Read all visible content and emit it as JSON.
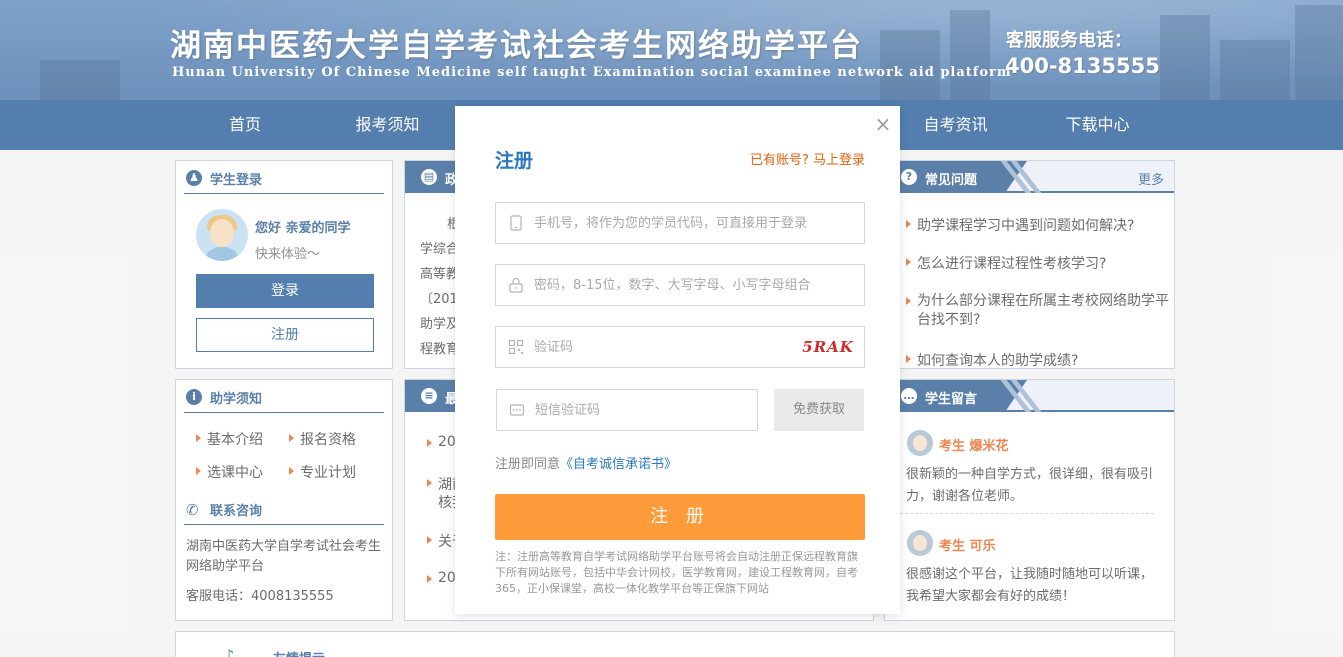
{
  "header": {
    "title": "湖南中医药大学自学考试社会考生网络助学平台",
    "subtitle": "Hunan University Of Chinese Medicine self taught Examination social examinee network aid platform",
    "hotline_label": "客服服务电话：",
    "hotline_number": "400-8135555"
  },
  "nav": [
    "首页",
    "报考须知",
    "自考资讯",
    "下载中心"
  ],
  "student_login": {
    "title": "学生登录",
    "greeting": "您好 亲爱的同学",
    "sub": "快来体验～",
    "login_label": "登录",
    "register_label": "注册"
  },
  "policy": {
    "title": "政",
    "lines": [
      "根",
      "学综合",
      "高等教",
      "〔201",
      "助学及",
      "程教育"
    ]
  },
  "faq": {
    "title": "常见问题",
    "more": "更多",
    "items": [
      "助学课程学习中遇到问题如何解决?",
      "怎么进行课程过程性考核学习?",
      "为什么部分课程在所属主考校网络助学平台找不到?",
      "如何查询本人的助学成绩?"
    ]
  },
  "guide": {
    "title": "助学须知",
    "items": [
      "基本介绍",
      "报名资格",
      "选课中心",
      "专业计划"
    ]
  },
  "contact": {
    "title": "联系咨询",
    "org": "湖南中医药大学自学考试社会考生网络助学平台",
    "phone": "客服电话：4008135555"
  },
  "latest": {
    "title": "最",
    "items": [
      "20",
      "湖南",
      "核我",
      "关于",
      "20"
    ]
  },
  "messages": {
    "title": "学生留言",
    "items": [
      {
        "name": "考生 爆米花",
        "text": "很新颖的一种自学方式，很详细，很有吸引力，谢谢各位老师。"
      },
      {
        "name": "考生 可乐",
        "text": "很感谢这个平台，让我随时随地可以听课，我希望大家都会有好的成绩！"
      }
    ]
  },
  "bottom": {
    "title": "友情提示"
  },
  "modal": {
    "close": "×",
    "title": "注册",
    "login_link": "已有账号? 马上登录",
    "phone_placeholder": "手机号，将作为您的学员代码，可直接用于登录",
    "password_placeholder": "密码，8-15位，数字、大写字母、小写字母组合",
    "captcha_placeholder": "验证码",
    "captcha_text": "5RAK",
    "sms_placeholder": "短信验证码",
    "sms_button": "免费获取",
    "agree_prefix": "注册即同意",
    "agree_link": "《自考诚信承诺书》",
    "submit": "注 册",
    "note": "注：注册高等教育自学考试网络助学平台账号将会自动注册正保远程教育旗下所有网站账号，包括中华会计网校，医学教育网，建设工程教育网，自考365，正小保课堂，高校一体化教学平台等正保旗下网站"
  },
  "colors": {
    "primary": "#114d8f",
    "accent": "#ff9b3a",
    "link": "#2a78c2",
    "orange_text": "#e0620d"
  }
}
